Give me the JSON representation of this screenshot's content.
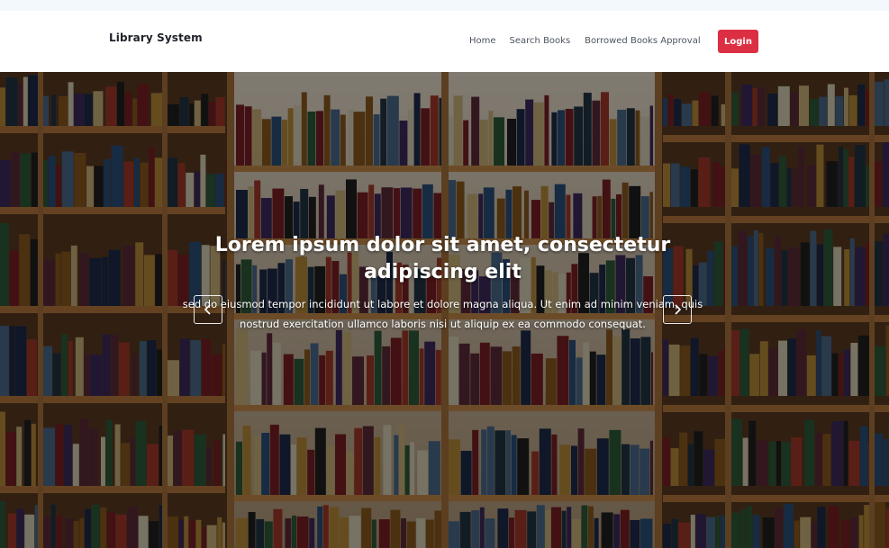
{
  "navbar": {
    "brand": "Library System",
    "links": [
      {
        "label": "Home"
      },
      {
        "label": "Search Books"
      },
      {
        "label": "Borrowed Books Approval"
      }
    ],
    "login_label": "Login",
    "login_color": "#dc2f43"
  },
  "hero": {
    "title": "Lorem ipsum dolor sit amet, consectetur adipiscing elit",
    "text": "sed do eiusmod tempor incididunt ut labore et dolore magna aliqua. Ut enim ad minim veniam, quis nostrud exercitation ullamco laboris nisi ut aliquip ex ea commodo consequat.",
    "prev_icon": "chevron-left-icon",
    "next_icon": "chevron-right-icon",
    "background": "bookshelves-photo"
  }
}
